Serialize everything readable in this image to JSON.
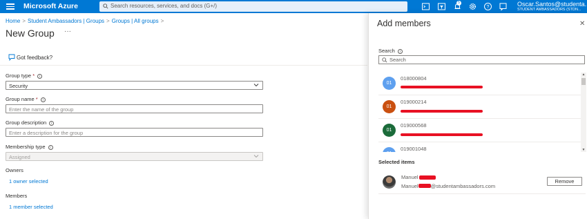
{
  "topbar": {
    "brand": "Microsoft Azure",
    "search_placeholder": "Search resources, services, and docs (G+/)",
    "notification_count": "5",
    "user_name": "Oscar.Santos@studenta...",
    "user_org": "STUDENT AMBASSADORS (STDN..."
  },
  "breadcrumb": {
    "items": [
      "Home",
      "Student Ambassadors | Groups",
      "Groups | All groups"
    ],
    "separator": ">"
  },
  "page": {
    "title": "New Group",
    "more": "···",
    "feedback": "Got feedback?"
  },
  "form": {
    "group_type": {
      "label": "Group type",
      "value": "Security"
    },
    "group_name": {
      "label": "Group name",
      "placeholder": "Enter the name of the group"
    },
    "group_description": {
      "label": "Group description",
      "placeholder": "Enter a description for the group"
    },
    "membership_type": {
      "label": "Membership type",
      "value": "Assigned"
    },
    "owners": {
      "label": "Owners",
      "link": "1 owner selected"
    },
    "members": {
      "label": "Members",
      "link": "1 member selected"
    },
    "required_mark": "*",
    "info_glyph": "i"
  },
  "panel": {
    "title": "Add members",
    "close": "✕",
    "search_label": "Search",
    "search_placeholder": "Search",
    "results": [
      {
        "initials": "01",
        "name": "018000804",
        "color": "#5ea0ef"
      },
      {
        "initials": "01",
        "name": "019000214",
        "color": "#ca5010"
      },
      {
        "initials": "01",
        "name": "019000568",
        "color": "#1b6b3a"
      },
      {
        "initials": "01",
        "name": "019001048",
        "color": "#5ea0ef"
      }
    ],
    "selected_label": "Selected items",
    "selected": {
      "name": "Manuel",
      "email_prefix": "Manuel",
      "email_suffix": "@studentambassadors.com",
      "remove_label": "Remove"
    }
  },
  "colors": {
    "accent": "#0078d4",
    "redaction": "#e81123"
  }
}
